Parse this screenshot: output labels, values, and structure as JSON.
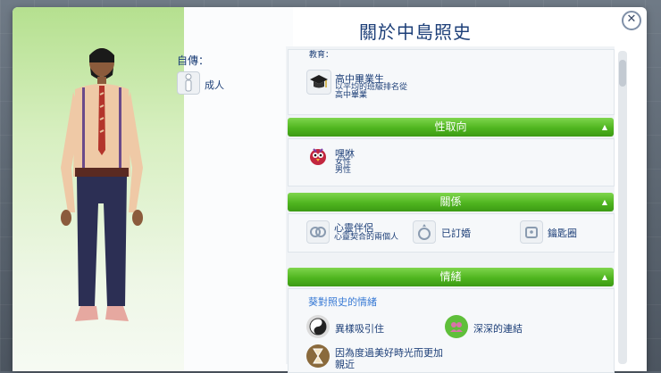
{
  "dialog": {
    "title": "關於中島照史",
    "close_glyph": "✕"
  },
  "bio": {
    "label": "自傳：",
    "age": "成人"
  },
  "education": {
    "header_partial": "教育：",
    "name": "高中畢業生",
    "desc_1": "以平均的班級排名從",
    "desc_2": "高中畢業"
  },
  "orientation": {
    "header": "性取向",
    "name": "嘿咻",
    "line_1": "女性",
    "line_2": "男性"
  },
  "relationship": {
    "header": "關係",
    "items": [
      {
        "title": "心靈伴侶",
        "subtitle": "心靈契合的兩個人",
        "icon": "soulmate-icon"
      },
      {
        "title": "已訂婚",
        "subtitle": "",
        "icon": "ring-icon"
      },
      {
        "title": "鑰匙圈",
        "subtitle": "",
        "icon": "key-icon"
      }
    ]
  },
  "emotion": {
    "header": "情緒",
    "sub_label": "葵對照史的情緒",
    "items": [
      {
        "label": "異樣吸引住",
        "icon": "yin-yang-icon"
      },
      {
        "label": "深深的連結",
        "icon": "connection-icon"
      },
      {
        "label_1": "因為度過美好時光而更加",
        "label_2": "親近",
        "icon": "hourglass-icon"
      }
    ]
  },
  "colors": {
    "accent_green": "#4fb51f",
    "title_blue": "#1d3f78"
  }
}
